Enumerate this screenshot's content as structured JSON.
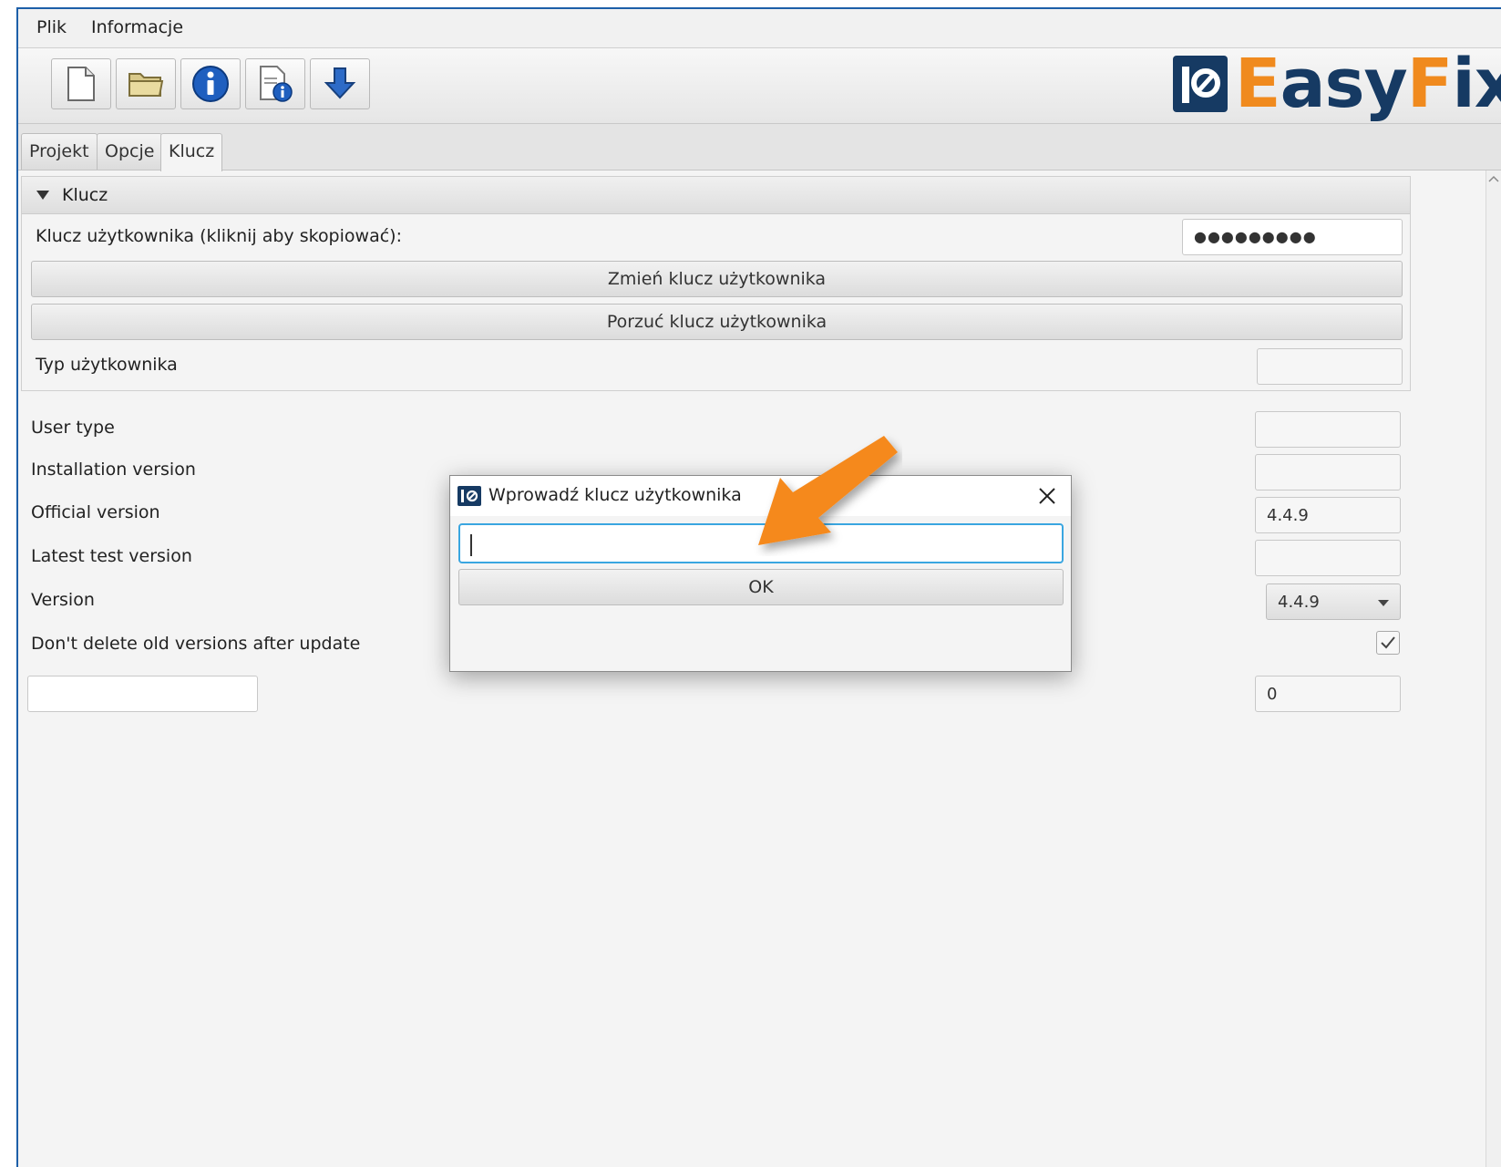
{
  "menu": {
    "items": [
      "Plik",
      "Informacje"
    ]
  },
  "toolbar": {
    "buttons": [
      "new-file-icon",
      "open-folder-icon",
      "info-icon",
      "document-info-icon",
      "download-icon"
    ]
  },
  "logo": {
    "text_e": "E",
    "text_asy": "asy",
    "text_f": "F",
    "text_ix": "ix",
    "colors": {
      "orange": "#f08a1e",
      "navy": "#163a63"
    }
  },
  "tabs": [
    "Projekt",
    "Opcje",
    "Klucz"
  ],
  "active_tab": "Klucz",
  "klucz_section": {
    "title": "Klucz",
    "user_key_label": "Klucz użytkownika (kliknij aby skopiować):",
    "user_key_value": "●●●●●●●●●",
    "change_key_button": "Zmień klucz użytkownika",
    "drop_key_button": "Porzuć klucz użytkownika",
    "user_type_label": "Typ użytkownika",
    "user_type_value": ""
  },
  "details": {
    "user_type_label": "User type",
    "user_type_value": "",
    "installation_version_label": "Installation version",
    "installation_version_value": "",
    "official_version_label": "Official version",
    "official_version_value": "4.4.9",
    "latest_test_version_label": "Latest test version",
    "latest_test_version_value": "",
    "version_label": "Version",
    "version_selected": "4.4.9",
    "dont_delete_label": "Don't delete old versions after update",
    "dont_delete_checked": true,
    "left_field_value": "",
    "right_field_value": "0"
  },
  "dialog": {
    "title": "Wprowadź klucz użytkownika",
    "input_value": "",
    "ok_button": "OK"
  },
  "annotation": {
    "arrow_color": "#f5891f"
  }
}
